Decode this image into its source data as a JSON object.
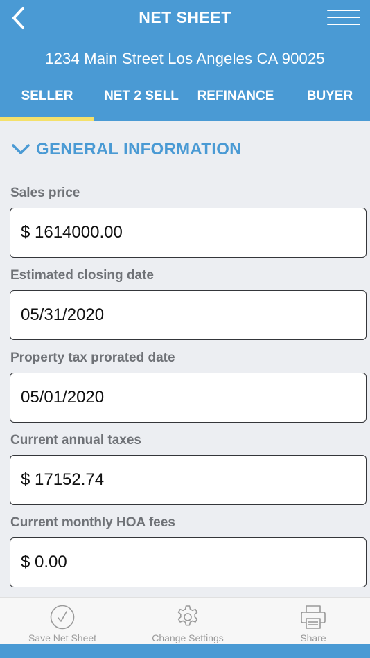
{
  "header": {
    "back_icon": "chevron-left-icon",
    "title": "NET SHEET",
    "menu_icon": "hamburger-menu-icon",
    "address": "1234 Main Street Los Angeles CA 90025",
    "color": "#4a9ad4"
  },
  "tabs": [
    {
      "label": "SELLER",
      "active": true
    },
    {
      "label": "NET 2 SELL",
      "active": false
    },
    {
      "label": "REFINANCE",
      "active": false
    },
    {
      "label": "BUYER",
      "active": false
    }
  ],
  "active_tab_indicator_color": "#f4e06a",
  "section": {
    "icon": "chevron-down-icon",
    "title": "GENERAL INFORMATION",
    "expanded": true
  },
  "fields": [
    {
      "label": "Sales price",
      "value": "$ 1614000.00"
    },
    {
      "label": "Estimated closing date",
      "value": "05/31/2020"
    },
    {
      "label": "Property tax prorated date",
      "value": "05/01/2020"
    },
    {
      "label": "Current annual taxes",
      "value": "$ 17152.74"
    },
    {
      "label": "Current monthly HOA fees",
      "value": "$ 0.00"
    }
  ],
  "bottom_bar": [
    {
      "label": "Save Net Sheet",
      "icon": "checkmark-circle-icon"
    },
    {
      "label": "Change Settings",
      "icon": "gear-icon"
    },
    {
      "label": "Share",
      "icon": "printer-icon"
    }
  ]
}
